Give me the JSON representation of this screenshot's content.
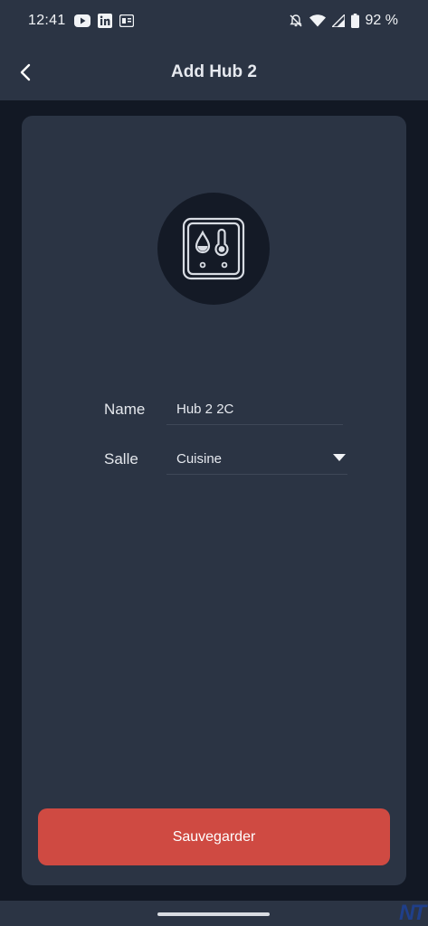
{
  "status_bar": {
    "time": "12:41",
    "battery": "92 %",
    "left_icons": [
      "youtube-icon",
      "linkedin-icon",
      "news-icon"
    ],
    "right_icons": [
      "bell-off-icon",
      "wifi-icon",
      "signal-icon",
      "battery-icon"
    ]
  },
  "app_bar": {
    "title": "Add Hub 2",
    "back_icon": "chevron-left-icon"
  },
  "device": {
    "icon": "hub-humidity-temperature-icon"
  },
  "form": {
    "name_label": "Name",
    "name_value": "Hub 2 2C",
    "room_label": "Salle",
    "room_value": "Cuisine"
  },
  "actions": {
    "save_label": "Sauvegarder"
  },
  "watermark": "NT",
  "colors": {
    "background": "#121824",
    "surface": "#2b3444",
    "accent": "#cf4a42",
    "icon_circle": "#141a26"
  }
}
